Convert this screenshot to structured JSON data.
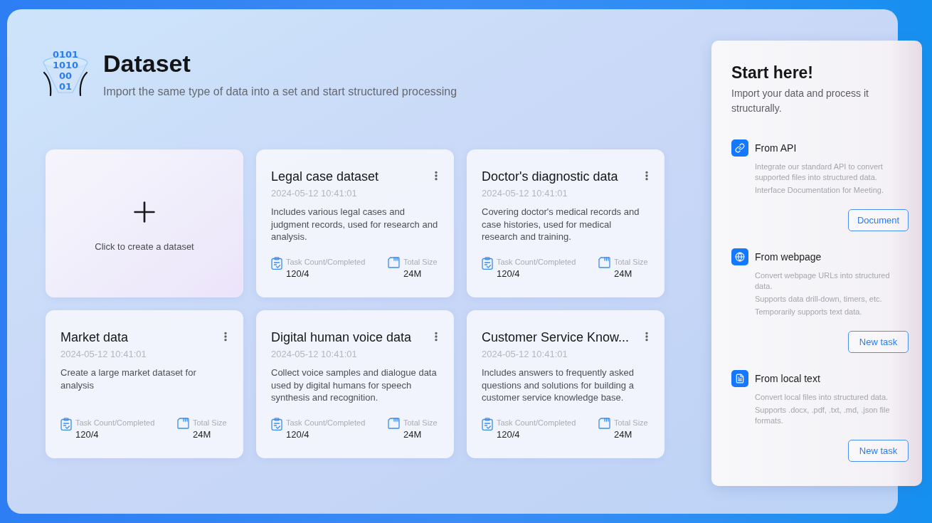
{
  "header": {
    "logo_digits": [
      "0101",
      "1010",
      "00",
      "01"
    ],
    "title": "Dataset",
    "subtitle": "Import the same type of data into a set and start structured processing"
  },
  "create_card": {
    "label": "Click to create a dataset"
  },
  "datasets": [
    {
      "title": "Legal case dataset",
      "date": "2024-05-12 10:41:01",
      "description": "Includes various legal cases and judgment records, used for research and analysis.",
      "stats": [
        {
          "kind": "tasks",
          "label": "Task Count/Completed",
          "value": "120/4"
        },
        {
          "kind": "size",
          "label": "Total Size",
          "value": "24M"
        }
      ]
    },
    {
      "title": "Doctor's diagnostic data",
      "date": "2024-05-12 10:41:01",
      "description": "Covering doctor's medical records and case histories, used for medical research and training.",
      "stats": [
        {
          "kind": "tasks",
          "label": "Task Count/Completed",
          "value": "120/4"
        },
        {
          "kind": "size",
          "label": "Total Size",
          "value": "24M"
        }
      ]
    },
    {
      "title": "Market data",
      "date": "2024-05-12 10:41:01",
      "description": "Create a large market dataset for analysis",
      "stats": [
        {
          "kind": "tasks",
          "label": "Task Count/Completed",
          "value": "120/4"
        },
        {
          "kind": "size",
          "label": "Total Size",
          "value": "24M"
        }
      ]
    },
    {
      "title": "Digital human voice data",
      "date": "2024-05-12 10:41:01",
      "description": "Collect voice samples and dialogue data used by digital humans for speech synthesis and recognition.",
      "stats": [
        {
          "kind": "tasks",
          "label": "Task Count/Completed",
          "value": "120/4"
        },
        {
          "kind": "size",
          "label": "Total Size",
          "value": "24M"
        }
      ]
    },
    {
      "title": "Customer Service Know...",
      "date": "2024-05-12 10:41:01",
      "description": "Includes answers to frequently asked questions and solutions for building a customer service knowledge base.",
      "stats": [
        {
          "kind": "tasks",
          "label": "Task Count/Completed",
          "value": "120/4"
        },
        {
          "kind": "size",
          "label": "Total Size",
          "value": "24M"
        }
      ]
    }
  ],
  "start_panel": {
    "title": "Start here!",
    "subtitle": "Import your data and process it structurally.",
    "sources": [
      {
        "kind": "api",
        "title": "From API",
        "notes": [
          "Integrate our standard API to convert supported files into structured data.",
          "Interface Documentation for Meeting."
        ],
        "button": "Document"
      },
      {
        "kind": "webpage",
        "title": "From webpage",
        "notes": [
          "Convert webpage URLs into structured data.",
          "Supports data drill-down, timers, etc.",
          "Temporarily supports text data."
        ],
        "button": "New task"
      },
      {
        "kind": "local",
        "title": "From local text",
        "notes": [
          "Convert local files into structured data.",
          "Supports .docx, .pdf, .txt, .md, .json file formats."
        ],
        "button": "New task"
      }
    ]
  }
}
